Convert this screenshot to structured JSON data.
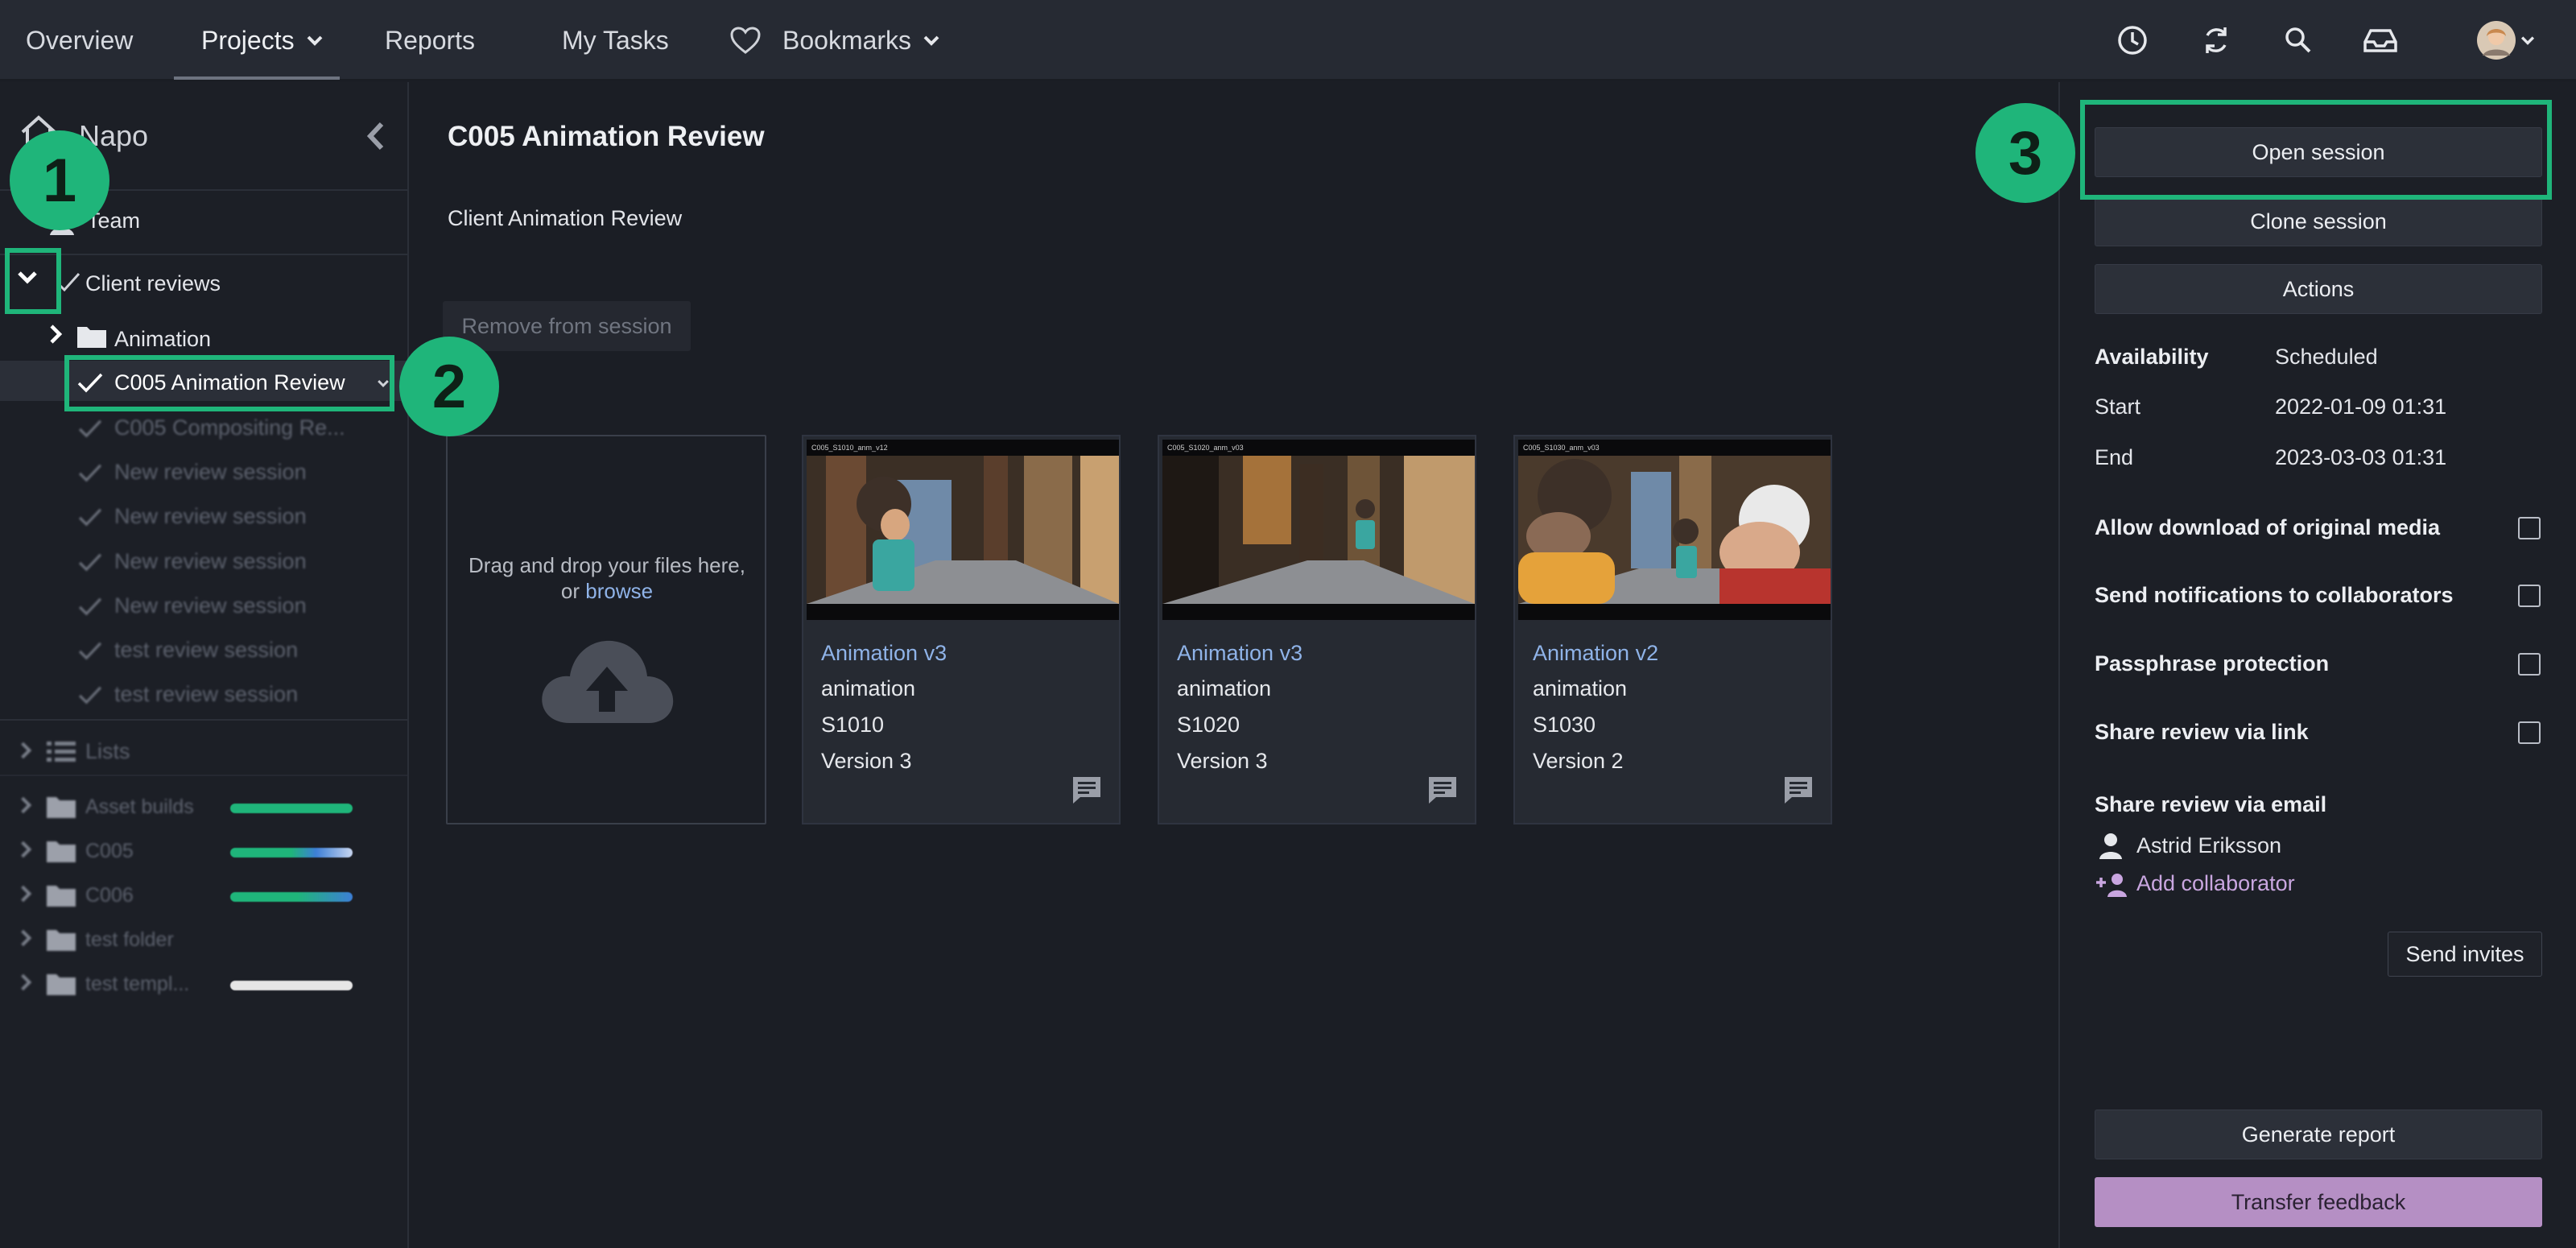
{
  "nav": {
    "items": [
      {
        "label": "Overview"
      },
      {
        "label": "Projects"
      },
      {
        "label": "Reports"
      },
      {
        "label": "My Tasks"
      },
      {
        "label": "Bookmarks"
      }
    ]
  },
  "sidebar": {
    "project_name": "Napo",
    "team_label": "Team",
    "client_reviews_label": "Client reviews",
    "animation_folder_label": "Animation",
    "selected_session_label": "C005 Animation Review",
    "sessions": [
      {
        "label": "C005 Compositing Re..."
      },
      {
        "label": "New review session"
      },
      {
        "label": "New review session"
      },
      {
        "label": "New review session"
      },
      {
        "label": "New review session"
      },
      {
        "label": "test review session"
      },
      {
        "label": "test review session"
      }
    ],
    "lists_label": "Lists",
    "folders": [
      {
        "label": "Asset builds",
        "color": "#1fb57a"
      },
      {
        "label": "C005",
        "color": "#1fb57a"
      },
      {
        "label": "C006",
        "color": "#1fb57a"
      },
      {
        "label": "test folder",
        "color": ""
      },
      {
        "label": "test templ...",
        "color": "#e6e6e6"
      }
    ]
  },
  "main": {
    "title": "C005 Animation Review",
    "subtitle": "Client Animation Review",
    "remove_button": "Remove from session",
    "dropzone_text": "Drag and drop your files here, or",
    "dropzone_link": "browse",
    "cards": [
      {
        "name": "Animation v3",
        "type": "animation",
        "shot": "S1010",
        "version": "Version 3",
        "thumb_caption": "C005_S1010_anm_v12"
      },
      {
        "name": "Animation v3",
        "type": "animation",
        "shot": "S1020",
        "version": "Version 3",
        "thumb_caption": "C005_S1020_anm_v03"
      },
      {
        "name": "Animation v2",
        "type": "animation",
        "shot": "S1030",
        "version": "Version 2",
        "thumb_caption": "C005_S1030_anm_v03"
      }
    ]
  },
  "panel": {
    "open_session": "Open session",
    "clone_session": "Clone session",
    "actions": "Actions",
    "availability_label": "Availability",
    "availability_value": "Scheduled",
    "start_label": "Start",
    "start_value": "2022-01-09 01:31",
    "end_label": "End",
    "end_value": "2023-03-03 01:31",
    "options": [
      {
        "label": "Allow download of original media",
        "checked": false
      },
      {
        "label": "Send notifications to collaborators",
        "checked": false
      },
      {
        "label": "Passphrase protection",
        "checked": false
      },
      {
        "label": "Share review via link",
        "checked": false
      }
    ],
    "share_email_label": "Share review via email",
    "collaborator_name": "Astrid Eriksson",
    "add_collaborator": "Add collaborator",
    "send_invites": "Send invites",
    "generate_report": "Generate report",
    "transfer_feedback": "Transfer feedback"
  },
  "annotations": [
    {
      "number": "1"
    },
    {
      "number": "2"
    },
    {
      "number": "3"
    }
  ],
  "colors": {
    "accent_green": "#1fb57a",
    "transfer_button": "#b58fc4",
    "link_blue": "#8fb3e8",
    "add_collaborator": "#c9a6e0"
  }
}
